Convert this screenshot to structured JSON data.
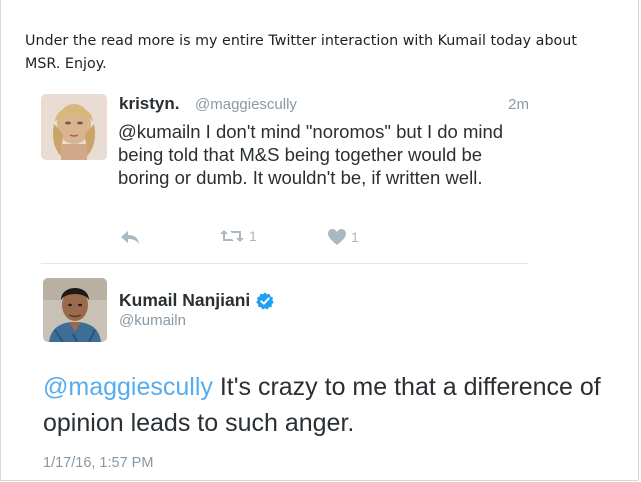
{
  "post": {
    "intro_text": "Under the read more is my entire Twitter interaction with Kumail today about MSR. Enjoy."
  },
  "tweet1": {
    "display_name": "kristyn.",
    "handle": "@maggiescully",
    "time": "2m",
    "text": "@kumailn I don't mind \"noromos\" but I do mind being told that M&S being together would be boring or dumb. It wouldn't be, if written well.",
    "actions": {
      "reply_icon": "reply-icon",
      "retweet_icon": "retweet-icon",
      "retweet_count": "1",
      "like_icon": "heart-icon",
      "like_count": "1"
    }
  },
  "tweet2": {
    "display_name": "Kumail Nanjiani",
    "verified_icon": "verified-badge-icon",
    "handle": "@kumailn",
    "mention": "@maggiescully",
    "text_rest": " It's crazy to me that a difference of opinion leads to such anger.",
    "date": "1/17/16, 1:57 PM"
  },
  "colors": {
    "link_blue": "#55acee",
    "verified_blue": "#1da1f2",
    "muted_gray": "#8899a6",
    "icon_gray": "#aab8c2",
    "text_dark": "#292f33"
  }
}
